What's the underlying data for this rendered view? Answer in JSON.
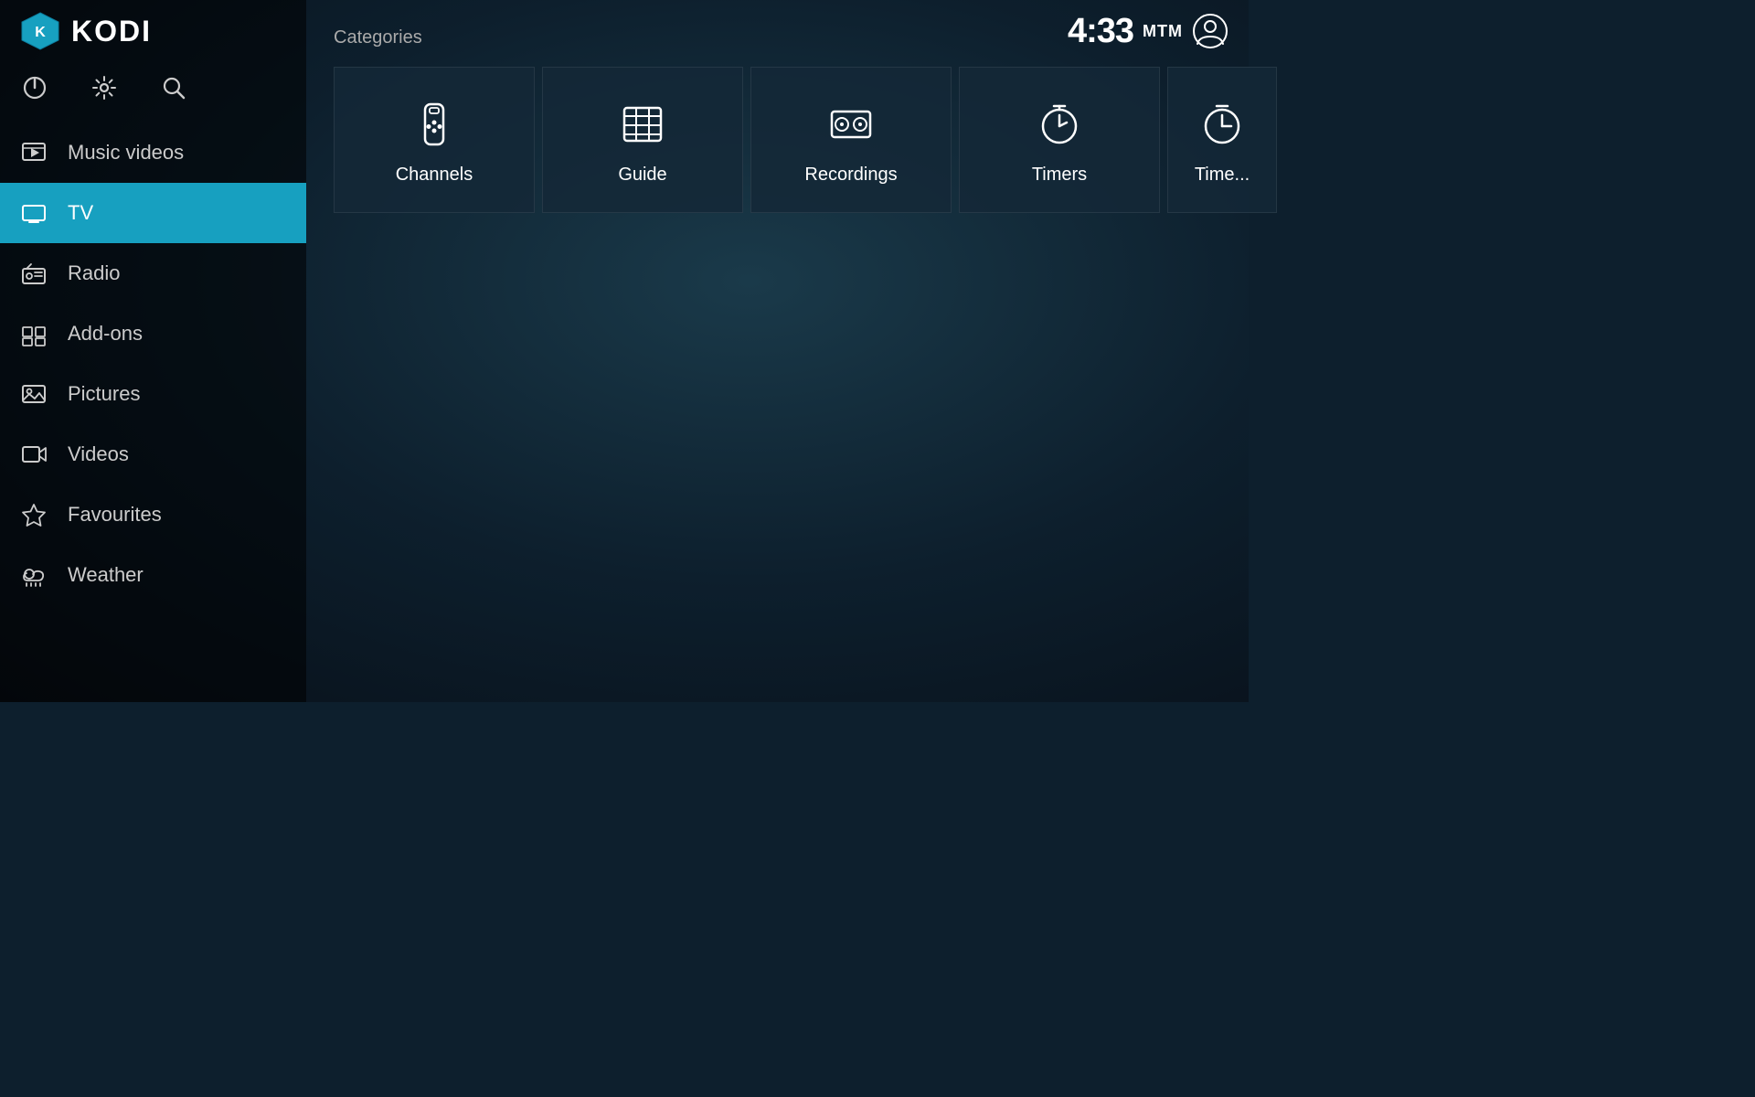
{
  "app": {
    "name": "KODI",
    "clock": "4:33"
  },
  "toolbar": {
    "power_label": "Power",
    "settings_label": "Settings",
    "search_label": "Search"
  },
  "sidebar": {
    "items": [
      {
        "id": "music-videos",
        "label": "Music videos",
        "icon": "music-video-icon"
      },
      {
        "id": "tv",
        "label": "TV",
        "icon": "tv-icon",
        "active": true
      },
      {
        "id": "radio",
        "label": "Radio",
        "icon": "radio-icon"
      },
      {
        "id": "add-ons",
        "label": "Add-ons",
        "icon": "addons-icon"
      },
      {
        "id": "pictures",
        "label": "Pictures",
        "icon": "pictures-icon"
      },
      {
        "id": "videos",
        "label": "Videos",
        "icon": "videos-icon"
      },
      {
        "id": "favourites",
        "label": "Favourites",
        "icon": "favourites-icon"
      },
      {
        "id": "weather",
        "label": "Weather",
        "icon": "weather-icon"
      }
    ]
  },
  "main": {
    "categories_label": "Categories",
    "cards": [
      {
        "id": "channels",
        "label": "Channels",
        "icon": "remote-icon"
      },
      {
        "id": "guide",
        "label": "Guide",
        "icon": "guide-icon"
      },
      {
        "id": "recordings",
        "label": "Recordings",
        "icon": "recordings-icon"
      },
      {
        "id": "timers",
        "label": "Timers",
        "icon": "timers-icon"
      },
      {
        "id": "timers2",
        "label": "Time...",
        "icon": "timers2-icon"
      }
    ]
  }
}
